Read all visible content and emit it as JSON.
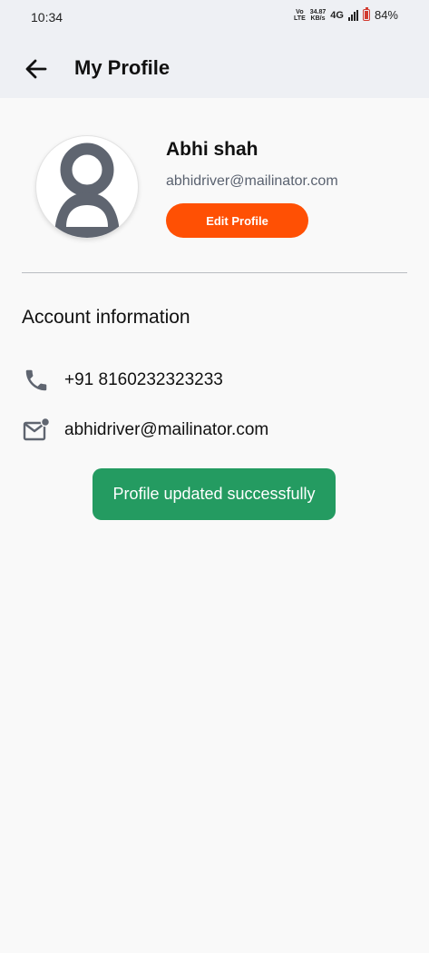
{
  "status_bar": {
    "time": "10:34",
    "volte_top": "Vo",
    "volte_bottom": "LTE",
    "speed_value": "34.87",
    "speed_unit": "KB/s",
    "network": "4G",
    "battery": "84%"
  },
  "header": {
    "back_icon": "arrow-left-icon",
    "title": "My Profile"
  },
  "profile": {
    "name": "Abhi shah",
    "email": "abhidriver@mailinator.com",
    "edit_label": "Edit Profile",
    "avatar_icon": "person-icon"
  },
  "account": {
    "section_title": "Account information",
    "phone": "+91 8160232323233",
    "email": "abhidriver@mailinator.com",
    "phone_icon": "phone-icon",
    "email_icon": "mail-notification-icon"
  },
  "toast": {
    "message": "Profile updated successfully"
  },
  "colors": {
    "accent": "#ff5004",
    "success": "#249b61",
    "header_bg": "#eef0f4",
    "muted_text": "#5a6270"
  }
}
